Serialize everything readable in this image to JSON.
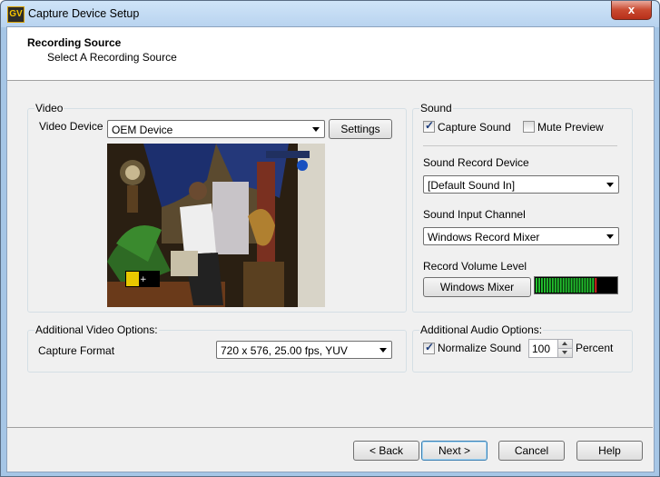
{
  "window": {
    "title": "Capture Device Setup",
    "icon_text": "GV",
    "close_glyph": "x"
  },
  "header": {
    "title": "Recording Source",
    "subtitle": "Select A Recording Source"
  },
  "video": {
    "group_label": "Video",
    "device_label": "Video Device",
    "device_value": "OEM Device",
    "settings_button": "Settings"
  },
  "sound": {
    "group_label": "Sound",
    "capture_sound_label": "Capture Sound",
    "capture_sound_checked": true,
    "mute_preview_label": "Mute Preview",
    "mute_preview_checked": false,
    "record_device_label": "Sound Record Device",
    "record_device_value": "[Default Sound In]",
    "input_channel_label": "Sound Input Channel",
    "input_channel_value": "Windows Record Mixer",
    "volume_label": "Record Volume Level",
    "mixer_button": "Windows Mixer",
    "volume_level": 0.77
  },
  "additional_video": {
    "group_label": "Additional Video Options:",
    "format_label": "Capture Format",
    "format_value": "720 x 576, 25.00 fps, YUV"
  },
  "additional_audio": {
    "group_label": "Additional Audio Options:",
    "normalize_label": "Normalize Sound",
    "normalize_checked": true,
    "percent_value": "100",
    "percent_label": "Percent"
  },
  "footer": {
    "back": "< Back",
    "next": "Next >",
    "cancel": "Cancel",
    "help": "Help"
  },
  "colors": {
    "meter_on": "#22c22e",
    "meter_peak": "#d82020",
    "title_gradient": "#b8d3ef"
  },
  "icons": {
    "close": "close-icon",
    "dropdown": "chevron-down-icon",
    "check": "checkmark-icon"
  }
}
